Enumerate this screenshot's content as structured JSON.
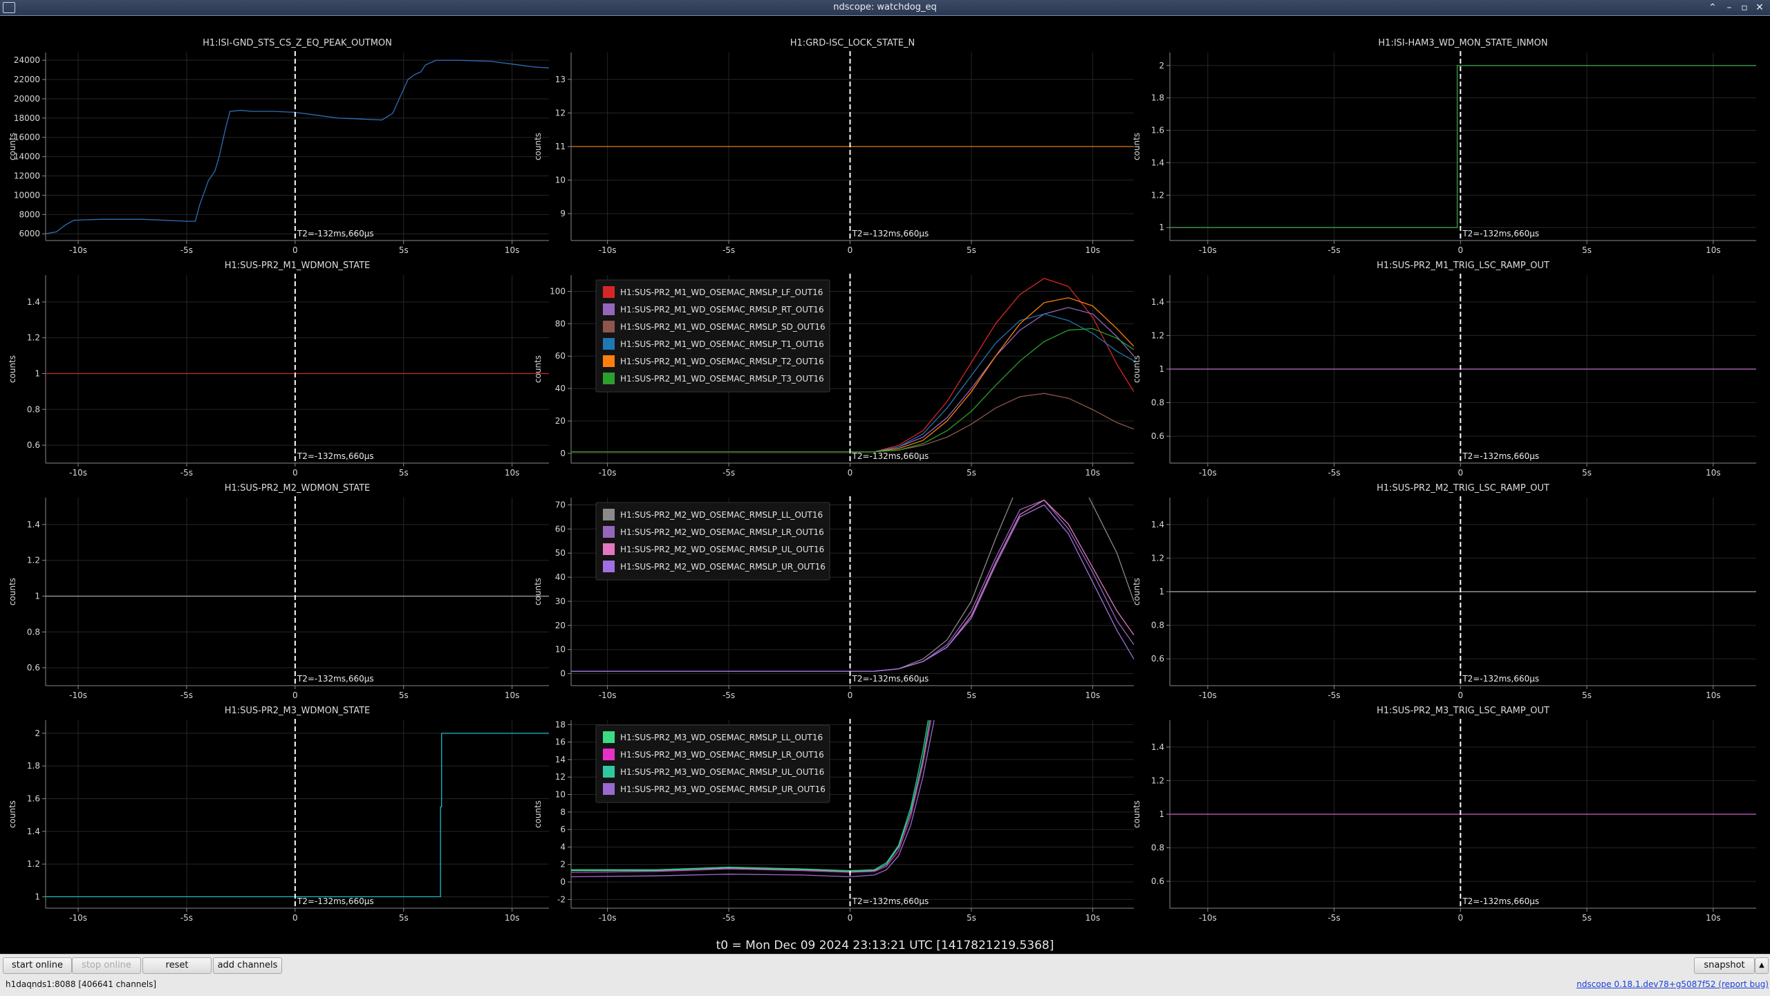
{
  "window": {
    "title": "ndscope: watchdog_eq"
  },
  "x_axis": {
    "ticks": [
      -10,
      -5,
      0,
      5,
      10
    ],
    "tick_labels": [
      "-10s",
      "-5s",
      "0",
      "5s",
      "10s"
    ],
    "xlim": [
      -11.5,
      11.7
    ]
  },
  "cursor_label": "T2=-132ms,660µs",
  "ylabel": "counts",
  "footer": {
    "t0": "t0 = Mon Dec 09 2024 23:13:21 UTC [1417821219.5368]"
  },
  "toolbar": {
    "start_online": "start online",
    "stop_online": "stop online",
    "reset": "reset",
    "add_channels": "add channels",
    "snapshot": "snapshot",
    "snapshot_menu_icon": "triangle-up-icon"
  },
  "status": {
    "server": "h1daqnds1:8088  [406641 channels]",
    "version": "ndscope 0.18.1.dev78+g5087f52 (report bug)"
  },
  "plots": [
    {
      "id": "isi-gnd-sts",
      "title": "H1:ISI-GND_STS_CS_Z_EQ_PEAK_OUTMON",
      "ylim": [
        5300,
        24800
      ],
      "yticks": [
        6000,
        8000,
        10000,
        12000,
        14000,
        16000,
        18000,
        20000,
        22000,
        24000
      ],
      "series": [
        {
          "name": "H1:ISI-GND_STS_CS_Z_EQ_PEAK_OUTMON",
          "color": "#2d6fb5",
          "x": [
            -11.5,
            -11.0,
            -10.6,
            -10.2,
            -9.0,
            -8.0,
            -7.0,
            -6.0,
            -5.0,
            -4.6,
            -4.4,
            -4.0,
            -3.7,
            -3.5,
            -3.2,
            -3.0,
            -2.5,
            -2.0,
            -1.0,
            0.0,
            1.0,
            2.0,
            3.0,
            4.0,
            4.5,
            4.7,
            5.0,
            5.2,
            5.5,
            5.8,
            6.0,
            6.5,
            7.0,
            7.5,
            9.0,
            10.0,
            11.0,
            11.7
          ],
          "y": [
            6000,
            6200,
            6900,
            7400,
            7500,
            7500,
            7500,
            7400,
            7300,
            7300,
            9000,
            11500,
            12500,
            14000,
            17000,
            18700,
            18800,
            18700,
            18700,
            18600,
            18300,
            18000,
            17900,
            17800,
            18500,
            19500,
            21000,
            22000,
            22500,
            22800,
            23500,
            24000,
            24000,
            24000,
            23900,
            23600,
            23300,
            23200
          ]
        }
      ]
    },
    {
      "id": "grd-isc-lock",
      "title": "H1:GRD-ISC_LOCK_STATE_N",
      "ylim": [
        8.2,
        13.8
      ],
      "yticks": [
        9,
        10,
        11,
        12,
        13
      ],
      "series": [
        {
          "name": "H1:GRD-ISC_LOCK_STATE_N",
          "color": "#e07b12",
          "x": [
            -11.5,
            11.7
          ],
          "y": [
            11,
            11
          ]
        }
      ]
    },
    {
      "id": "isi-ham3-wd",
      "title": "H1:ISI-HAM3_WD_MON_STATE_INMON",
      "ylim": [
        0.92,
        2.08
      ],
      "yticks": [
        1,
        1.2,
        1.4,
        1.6,
        1.8,
        2
      ],
      "series": [
        {
          "name": "H1:ISI-HAM3_WD_MON_STATE_INMON",
          "color": "#3aa047",
          "x": [
            -11.5,
            -0.13,
            -0.13,
            11.7
          ],
          "y": [
            1,
            1,
            2,
            2
          ]
        }
      ]
    },
    {
      "id": "sus-pr2-m1-wd",
      "title": "H1:SUS-PR2_M1_WDMON_STATE",
      "ylim": [
        0.5,
        1.55
      ],
      "yticks": [
        0.6,
        0.8,
        1,
        1.2,
        1.4
      ],
      "series": [
        {
          "name": "H1:SUS-PR2_M1_WDMON_STATE",
          "color": "#c8282e",
          "x": [
            -11.5,
            11.7
          ],
          "y": [
            1,
            1
          ]
        }
      ]
    },
    {
      "id": "sus-pr2-m1-osem",
      "title": "",
      "ylim": [
        -6,
        110
      ],
      "yticks": [
        0,
        20,
        40,
        60,
        80,
        100
      ],
      "legend": true,
      "series": [
        {
          "name": "H1:SUS-PR2_M1_WD_OSEMAC_RMSLP_LF_OUT16",
          "color": "#d62728",
          "x": [
            -11.5,
            0,
            1,
            2,
            3,
            4,
            5,
            6,
            7,
            8,
            9,
            10,
            11,
            11.7
          ],
          "y": [
            1,
            1,
            1,
            5,
            14,
            32,
            56,
            80,
            98,
            108,
            103,
            84,
            55,
            38
          ]
        },
        {
          "name": "H1:SUS-PR2_M1_WD_OSEMAC_RMSLP_RT_OUT16",
          "color": "#9467bd",
          "x": [
            -11.5,
            0,
            1,
            2,
            3,
            4,
            5,
            6,
            7,
            8,
            9,
            10,
            11,
            11.7
          ],
          "y": [
            1,
            1,
            1,
            4,
            10,
            22,
            40,
            60,
            76,
            86,
            90,
            86,
            72,
            60
          ]
        },
        {
          "name": "H1:SUS-PR2_M1_WD_OSEMAC_RMSLP_SD_OUT16",
          "color": "#8c564b",
          "x": [
            -11.5,
            0,
            1,
            2,
            3,
            4,
            5,
            6,
            7,
            8,
            9,
            10,
            11,
            11.7
          ],
          "y": [
            1,
            1,
            1,
            2,
            5,
            10,
            18,
            28,
            35,
            37,
            34,
            27,
            19,
            15
          ]
        },
        {
          "name": "H1:SUS-PR2_M1_WD_OSEMAC_RMSLP_T1_OUT16",
          "color": "#1f77b4",
          "x": [
            -11.5,
            0,
            1,
            2,
            3,
            4,
            5,
            6,
            7,
            8,
            9,
            10,
            11,
            11.7
          ],
          "y": [
            1,
            1,
            1,
            4,
            12,
            28,
            48,
            68,
            82,
            86,
            82,
            74,
            63,
            57
          ]
        },
        {
          "name": "H1:SUS-PR2_M1_WD_OSEMAC_RMSLP_T2_OUT16",
          "color": "#ff7f0e",
          "x": [
            -11.5,
            0,
            1,
            2,
            3,
            4,
            5,
            6,
            7,
            8,
            9,
            10,
            11,
            11.7
          ],
          "y": [
            1,
            1,
            1,
            3,
            8,
            20,
            38,
            60,
            80,
            93,
            96,
            91,
            77,
            66
          ]
        },
        {
          "name": "H1:SUS-PR2_M1_WD_OSEMAC_RMSLP_T3_OUT16",
          "color": "#2ca02c",
          "x": [
            -11.5,
            0,
            1,
            2,
            3,
            4,
            5,
            6,
            7,
            8,
            9,
            10,
            11,
            11.7
          ],
          "y": [
            1,
            1,
            1,
            2,
            6,
            14,
            26,
            42,
            57,
            69,
            76,
            77,
            71,
            64
          ]
        }
      ]
    },
    {
      "id": "sus-pr2-m1-trig",
      "title": "H1:SUS-PR2_M1_TRIG_LSC_RAMP_OUT",
      "ylim": [
        0.44,
        1.56
      ],
      "yticks": [
        0.4,
        0.6,
        0.8,
        1,
        1.2,
        1.4,
        1.6
      ],
      "series": [
        {
          "name": "H1:SUS-PR2_M1_TRIG_LSC_RAMP_OUT",
          "color": "#c070c8",
          "x": [
            -11.5,
            11.7
          ],
          "y": [
            1,
            1
          ]
        }
      ]
    },
    {
      "id": "sus-pr2-m2-wd",
      "title": "H1:SUS-PR2_M2_WDMON_STATE",
      "ylim": [
        0.5,
        1.55
      ],
      "yticks": [
        0.6,
        0.8,
        1,
        1.2,
        1.4
      ],
      "series": [
        {
          "name": "H1:SUS-PR2_M2_WDMON_STATE",
          "color": "#a8a8a8",
          "x": [
            -11.5,
            11.7
          ],
          "y": [
            1,
            1
          ]
        }
      ]
    },
    {
      "id": "sus-pr2-m2-osem",
      "title": "",
      "ylim": [
        -5,
        73
      ],
      "yticks": [
        0,
        10,
        20,
        30,
        40,
        50,
        60,
        70
      ],
      "legend": true,
      "series": [
        {
          "name": "H1:SUS-PR2_M2_WD_OSEMAC_RMSLP_LL_OUT16",
          "color": "#8a8a8a",
          "x": [
            -11.5,
            0,
            1,
            2,
            3,
            4,
            5,
            6,
            7,
            8,
            9,
            10,
            11,
            11.7
          ],
          "y": [
            1,
            1,
            1,
            2,
            6,
            14,
            30,
            56,
            80,
            95,
            90,
            70,
            50,
            30
          ]
        },
        {
          "name": "H1:SUS-PR2_M2_WD_OSEMAC_RMSLP_LR_OUT16",
          "color": "#9467bd",
          "x": [
            -11.5,
            0,
            1,
            2,
            3,
            4,
            5,
            6,
            7,
            8,
            9,
            10,
            11,
            11.7
          ],
          "y": [
            1,
            1,
            1,
            2,
            5,
            12,
            26,
            48,
            68,
            72,
            60,
            42,
            22,
            12
          ]
        },
        {
          "name": "H1:SUS-PR2_M2_WD_OSEMAC_RMSLP_UL_OUT16",
          "color": "#e377c2",
          "x": [
            -11.5,
            0,
            1,
            2,
            3,
            4,
            5,
            6,
            7,
            8,
            9,
            10,
            11,
            11.7
          ],
          "y": [
            1,
            1,
            1,
            2,
            5,
            11,
            24,
            46,
            66,
            72,
            62,
            44,
            26,
            16
          ]
        },
        {
          "name": "H1:SUS-PR2_M2_WD_OSEMAC_RMSLP_UR_OUT16",
          "color": "#a070e0",
          "x": [
            -11.5,
            0,
            1,
            2,
            3,
            4,
            5,
            6,
            7,
            8,
            9,
            10,
            11,
            11.7
          ],
          "y": [
            1,
            1,
            1,
            2,
            5,
            11,
            23,
            45,
            65,
            70,
            58,
            38,
            18,
            6
          ]
        }
      ]
    },
    {
      "id": "sus-pr2-m2-trig",
      "title": "H1:SUS-PR2_M2_TRIG_LSC_RAMP_OUT",
      "ylim": [
        0.44,
        1.56
      ],
      "yticks": [
        0.4,
        0.6,
        0.8,
        1,
        1.2,
        1.4,
        1.6
      ],
      "series": [
        {
          "name": "H1:SUS-PR2_M2_TRIG_LSC_RAMP_OUT",
          "color": "#b0b0b0",
          "x": [
            -11.5,
            11.7
          ],
          "y": [
            1,
            1
          ]
        }
      ]
    },
    {
      "id": "sus-pr2-m3-wd",
      "title": "H1:SUS-PR2_M3_WDMON_STATE",
      "ylim": [
        0.93,
        2.08
      ],
      "yticks": [
        1,
        1.2,
        1.4,
        1.6,
        1.8,
        2
      ],
      "series": [
        {
          "name": "H1:SUS-PR2_M3_WDMON_STATE",
          "color": "#17becf",
          "x": [
            -11.5,
            6.7,
            6.7,
            6.75,
            6.75,
            11.7
          ],
          "y": [
            1,
            1,
            1.55,
            1.55,
            2,
            2
          ]
        }
      ]
    },
    {
      "id": "sus-pr2-m3-osem",
      "title": "",
      "ylim": [
        -3,
        18.5
      ],
      "yticks": [
        -2,
        0,
        2,
        4,
        6,
        8,
        10,
        12,
        14,
        16,
        18
      ],
      "legend": true,
      "series": [
        {
          "name": "H1:SUS-PR2_M3_WD_OSEMAC_RMSLP_LL_OUT16",
          "color": "#3ddc84",
          "x": [
            -11.5,
            -8,
            -5,
            -2,
            0,
            1,
            1.5,
            2,
            2.5,
            3,
            3.5
          ],
          "y": [
            1.3,
            1.3,
            1.6,
            1.4,
            1.2,
            1.3,
            2,
            4,
            8,
            14,
            22
          ]
        },
        {
          "name": "H1:SUS-PR2_M3_WD_OSEMAC_RMSLP_LR_OUT16",
          "color": "#e830c8",
          "x": [
            -11.5,
            -8,
            -5,
            -2,
            0,
            1,
            1.5,
            2,
            2.5,
            3,
            3.5
          ],
          "y": [
            1.1,
            1.2,
            1.5,
            1.3,
            1.1,
            1.2,
            1.8,
            3.6,
            7.5,
            13.5,
            21
          ]
        },
        {
          "name": "H1:SUS-PR2_M3_WD_OSEMAC_RMSLP_UL_OUT16",
          "color": "#30c8a0",
          "x": [
            -11.5,
            -8,
            -5,
            -2,
            0,
            1,
            1.5,
            2,
            2.5,
            3,
            3.5
          ],
          "y": [
            1.4,
            1.4,
            1.7,
            1.5,
            1.3,
            1.4,
            2.2,
            4.2,
            8.5,
            15,
            23
          ]
        },
        {
          "name": "H1:SUS-PR2_M3_WD_OSEMAC_RMSLP_UR_OUT16",
          "color": "#9a6ad0",
          "x": [
            -11.5,
            -8,
            -5,
            -2,
            0,
            1,
            1.5,
            2,
            2.5,
            3,
            3.5
          ],
          "y": [
            0.6,
            0.7,
            0.9,
            0.8,
            0.6,
            0.8,
            1.4,
            3,
            6.5,
            12,
            19
          ]
        }
      ]
    },
    {
      "id": "sus-pr2-m3-trig",
      "title": "H1:SUS-PR2_M3_TRIG_LSC_RAMP_OUT",
      "ylim": [
        0.44,
        1.56
      ],
      "yticks": [
        0.4,
        0.6,
        0.8,
        1,
        1.2,
        1.4,
        1.6
      ],
      "series": [
        {
          "name": "H1:SUS-PR2_M3_TRIG_LSC_RAMP_OUT",
          "color": "#d060d0",
          "x": [
            -11.5,
            11.7
          ],
          "y": [
            1,
            1
          ]
        }
      ]
    }
  ]
}
